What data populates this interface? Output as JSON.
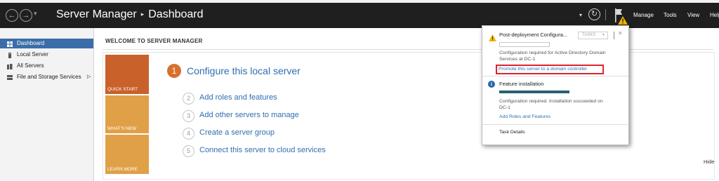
{
  "header": {
    "title": "Server Manager",
    "separator": "▸",
    "page": "Dashboard",
    "back_icon": "back-arrow-icon",
    "forward_icon": "forward-arrow-icon",
    "refresh_icon": "refresh-icon",
    "flag_icon": "notification-flag-icon",
    "menu": [
      "Manage",
      "Tools",
      "View",
      "Help"
    ]
  },
  "sidebar": {
    "items": [
      {
        "label": "Dashboard",
        "active": true,
        "icon": "dashboard-icon"
      },
      {
        "label": "Local Server",
        "active": false,
        "icon": "server-icon"
      },
      {
        "label": "All Servers",
        "active": false,
        "icon": "servers-icon"
      },
      {
        "label": "File and Storage Services",
        "active": false,
        "icon": "storage-icon",
        "arrow": "▷"
      }
    ]
  },
  "main": {
    "welcome": "WELCOME TO SERVER MANAGER",
    "tiles": [
      "QUICK START",
      "WHAT'S NEW",
      "LEARN MORE"
    ],
    "primary_step": {
      "number": "1",
      "label": "Configure this local server"
    },
    "steps": [
      {
        "number": "2",
        "label": "Add roles and features"
      },
      {
        "number": "3",
        "label": "Add other servers to manage"
      },
      {
        "number": "4",
        "label": "Create a server group"
      },
      {
        "number": "5",
        "label": "Connect this server to cloud services"
      }
    ],
    "hide": "Hide"
  },
  "notifications": {
    "post_deploy": {
      "title": "Post-deployment Configura...",
      "tasks_label": "TASKS",
      "close": "✕",
      "line1": "Configuration required for Active Directory Domain",
      "line2": "Services at DC-1",
      "link": "Promote this server to a domain controller"
    },
    "feature": {
      "title": "Feature installation",
      "progress": 1.0,
      "line1": "Configuration required. Installation succeeded on",
      "line2": "DC-1",
      "link": "Add Roles and Features"
    },
    "task_details": "Task Details"
  },
  "colors": {
    "header_bg": "#1f1f1f",
    "accent_blue": "#3b6ea8",
    "tile_orange": "#c8622a",
    "tile_light": "#e0a048",
    "highlight_red": "#e0242c",
    "link_blue": "#2f6eb0"
  }
}
